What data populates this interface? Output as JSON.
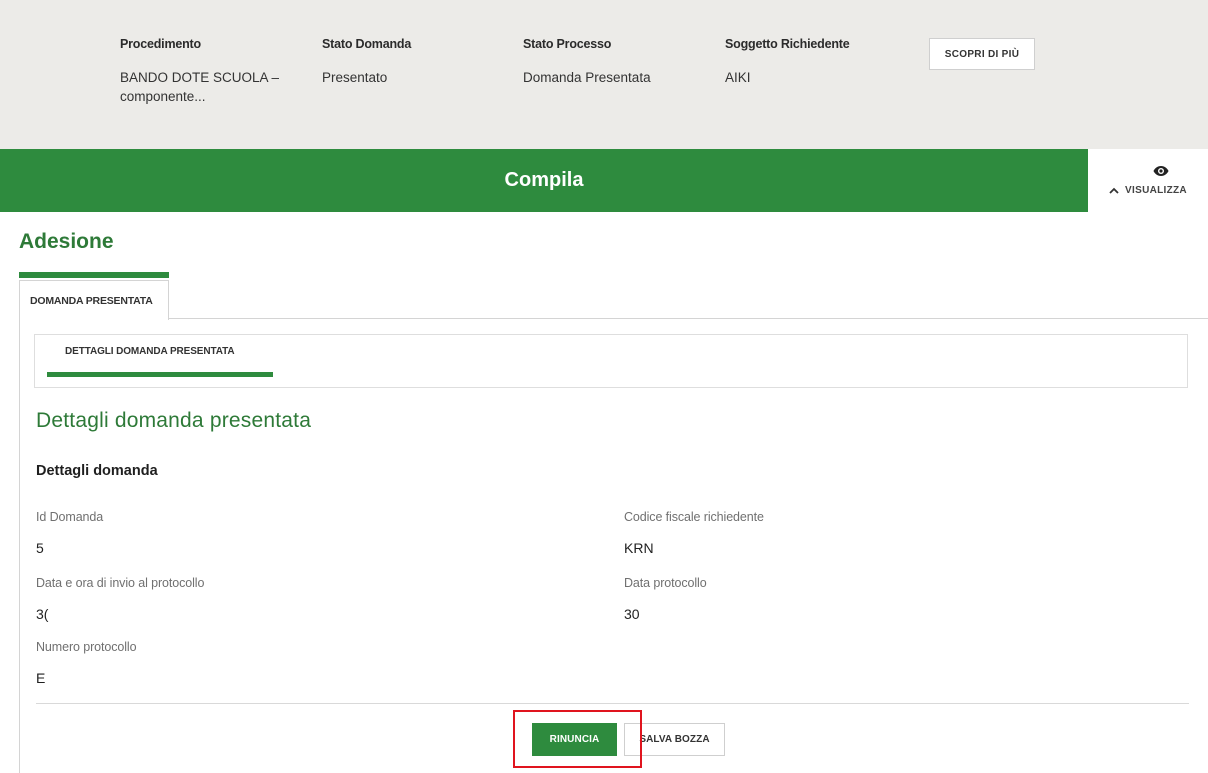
{
  "header": {
    "columns": [
      {
        "label": "Procedimento",
        "value": "BANDO DOTE SCUOLA – componente..."
      },
      {
        "label": "Stato Domanda",
        "value": "Presentato"
      },
      {
        "label": "Stato Processo",
        "value": "Domanda Presentata"
      },
      {
        "label": "Soggetto Richiedente",
        "value": "AIKI"
      }
    ],
    "scopri_label": "SCOPRI DI PIÙ"
  },
  "banner": {
    "title": "Compila",
    "visualizza_label": "VISUALIZZA",
    "eye_icon": "eye-icon",
    "chevron_icon": "chevron-up-icon"
  },
  "section_title": "Adesione",
  "tabs": [
    {
      "label": "DOMANDA PRESENTATA",
      "active": true
    }
  ],
  "subtabs": [
    {
      "label": "DETTAGLI DOMANDA PRESENTATA",
      "active": true
    }
  ],
  "page_heading": "Dettagli domanda presentata",
  "sub_heading": "Dettagli domanda",
  "fields": {
    "id_domanda": {
      "label": "Id Domanda",
      "value": "5"
    },
    "codice_fiscale": {
      "label": "Codice fiscale richiedente",
      "value": "KRN"
    },
    "data_invio": {
      "label": "Data e ora di invio al protocollo",
      "value": "3("
    },
    "data_protocollo": {
      "label": "Data protocollo",
      "value": "30"
    },
    "numero_protocollo": {
      "label": "Numero protocollo",
      "value": "E"
    }
  },
  "actions": {
    "rinuncia_label": "RINUNCIA",
    "salva_label": "SALVA BOZZA"
  },
  "colors": {
    "primary_green": "#2e8b3e",
    "heading_green": "#2e7a38",
    "header_bg": "#ecebe8",
    "highlight_red": "#e0141e"
  }
}
